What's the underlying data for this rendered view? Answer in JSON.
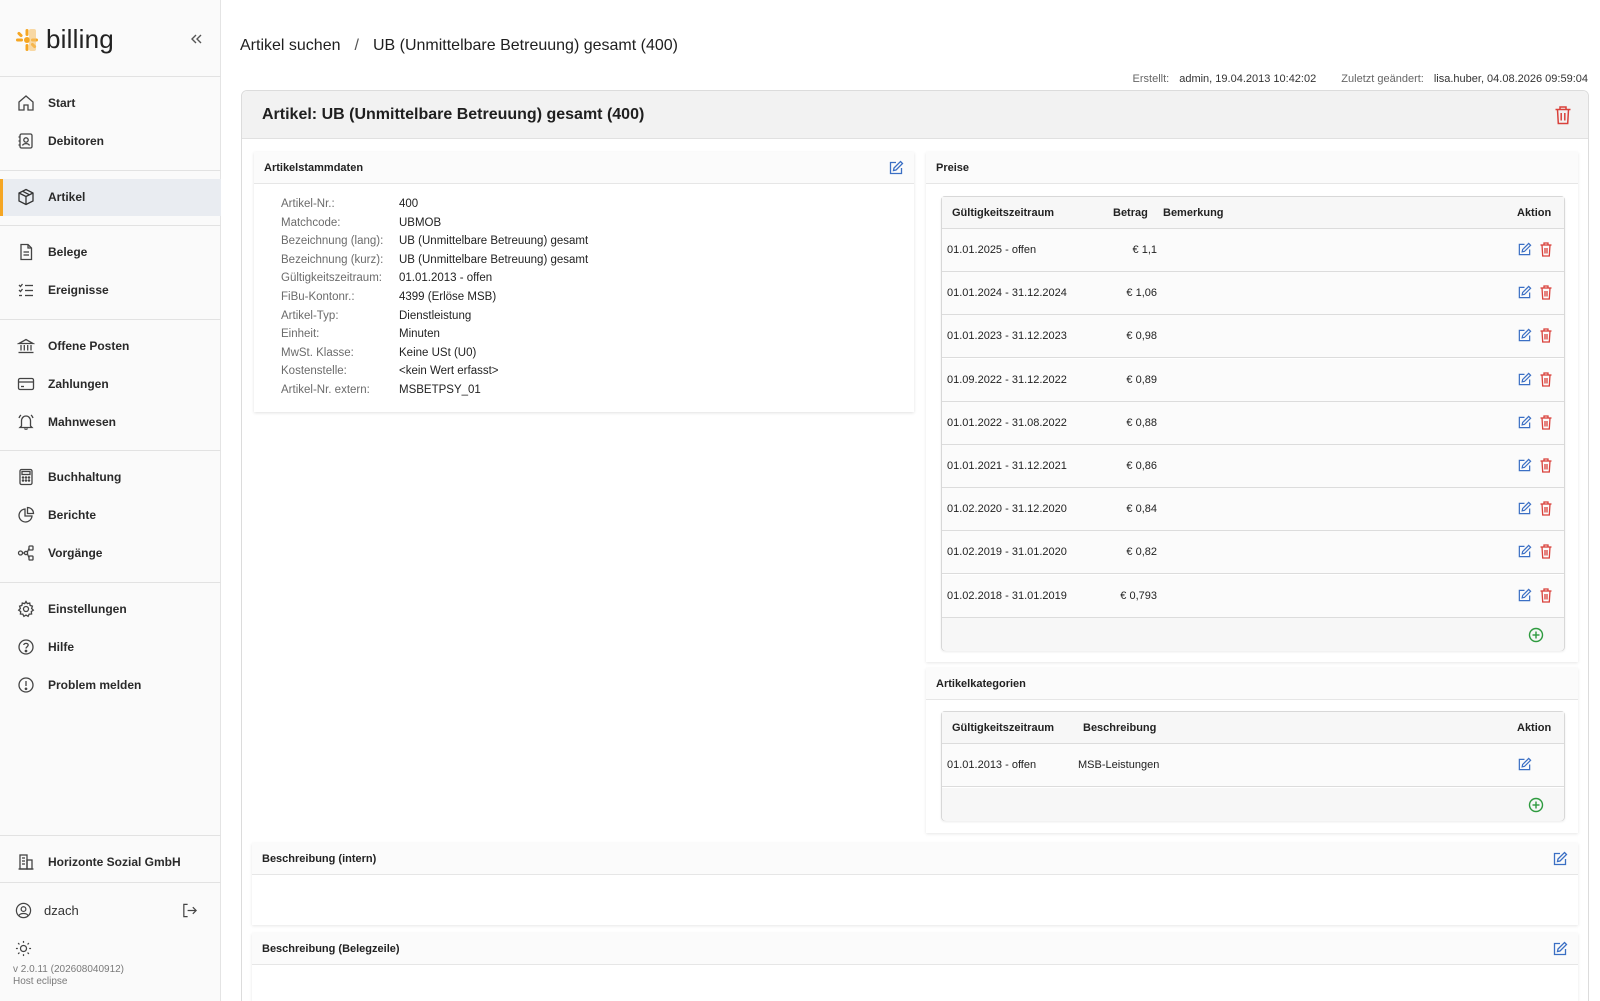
{
  "app": {
    "name": "billing"
  },
  "sidebar": {
    "items": [
      {
        "label": "Start",
        "icon": "home-icon"
      },
      {
        "label": "Debitoren",
        "icon": "contacts-icon"
      },
      {
        "label": "Artikel",
        "icon": "package-icon",
        "active": true
      },
      {
        "label": "Belege",
        "icon": "document-icon"
      },
      {
        "label": "Ereignisse",
        "icon": "checklist-icon"
      },
      {
        "label": "Offene Posten",
        "icon": "bank-icon"
      },
      {
        "label": "Zahlungen",
        "icon": "credit-card-icon"
      },
      {
        "label": "Mahnwesen",
        "icon": "bell-icon"
      },
      {
        "label": "Buchhaltung",
        "icon": "calculator-icon"
      },
      {
        "label": "Berichte",
        "icon": "pie-chart-icon"
      },
      {
        "label": "Vorgänge",
        "icon": "workflow-icon"
      },
      {
        "label": "Einstellungen",
        "icon": "gear-icon"
      },
      {
        "label": "Hilfe",
        "icon": "help-icon"
      },
      {
        "label": "Problem melden",
        "icon": "alert-icon"
      }
    ],
    "org": {
      "label": "Horizonte Sozial GmbH",
      "icon": "building-icon"
    },
    "user": {
      "name": "dzach"
    },
    "version": {
      "line1": "v 2.0.11 (202608040912)",
      "line2": "Host eclipse"
    }
  },
  "breadcrumb": {
    "parent": "Artikel suchen",
    "separator": "/",
    "current": "UB (Unmittelbare Betreuung) gesamt (400)"
  },
  "meta": {
    "created_label": "Erstellt:",
    "created_value": "admin, 19.04.2013 10:42:02",
    "changed_label": "Zuletzt geändert:",
    "changed_value": "lisa.huber, 04.08.2026 09:59:04"
  },
  "article": {
    "title": "Artikel: UB (Unmittelbare Betreuung) gesamt (400)",
    "stammdaten": {
      "title": "Artikelstammdaten",
      "fields": [
        {
          "k": "Artikel-Nr.:",
          "v": "400"
        },
        {
          "k": "Matchcode:",
          "v": "UBMOB"
        },
        {
          "k": "Bezeichnung (lang):",
          "v": "UB (Unmittelbare Betreuung) gesamt"
        },
        {
          "k": "Bezeichnung (kurz):",
          "v": "UB (Unmittelbare Betreuung) gesamt"
        },
        {
          "k": "Gültigkeitszeitraum:",
          "v": "01.01.2013 - offen"
        },
        {
          "k": "FiBu-Kontonr.:",
          "v": "4399 (Erlöse MSB)"
        },
        {
          "k": "Artikel-Typ:",
          "v": "Dienstleistung"
        },
        {
          "k": "Einheit:",
          "v": "Minuten"
        },
        {
          "k": "MwSt. Klasse:",
          "v": "Keine USt (U0)"
        },
        {
          "k": "Kostenstelle:",
          "v": "<kein Wert erfasst>"
        },
        {
          "k": "Artikel-Nr. extern:",
          "v": "MSBETPSY_01"
        }
      ]
    },
    "preise": {
      "title": "Preise",
      "columns": {
        "period": "Gültigkeitszeitraum",
        "amount": "Betrag",
        "note": "Bemerkung",
        "action": "Aktion"
      },
      "rows": [
        {
          "period": "01.01.2025 - offen",
          "amount": "€ 1,1",
          "note": ""
        },
        {
          "period": "01.01.2024 - 31.12.2024",
          "amount": "€ 1,06",
          "note": ""
        },
        {
          "period": "01.01.2023 - 31.12.2023",
          "amount": "€ 0,98",
          "note": ""
        },
        {
          "period": "01.09.2022 - 31.12.2022",
          "amount": "€ 0,89",
          "note": ""
        },
        {
          "period": "01.01.2022 - 31.08.2022",
          "amount": "€ 0,88",
          "note": ""
        },
        {
          "period": "01.01.2021 - 31.12.2021",
          "amount": "€ 0,86",
          "note": ""
        },
        {
          "period": "01.02.2020 - 31.12.2020",
          "amount": "€ 0,84",
          "note": ""
        },
        {
          "period": "01.02.2019 - 31.01.2020",
          "amount": "€ 0,82",
          "note": ""
        },
        {
          "period": "01.02.2018 - 31.01.2019",
          "amount": "€ 0,793",
          "note": ""
        }
      ]
    },
    "kategorien": {
      "title": "Artikelkategorien",
      "columns": {
        "period": "Gültigkeitszeitraum",
        "desc": "Beschreibung",
        "action": "Aktion"
      },
      "rows": [
        {
          "period": "01.01.2013 - offen",
          "desc": "MSB-Leistungen"
        }
      ]
    },
    "beschreibung_intern": {
      "title": "Beschreibung (intern)",
      "text": ""
    },
    "beschreibung_beleg": {
      "title": "Beschreibung (Belegzeile)",
      "text": ""
    }
  },
  "colors": {
    "accent": "#f5a623",
    "edit": "#3b6fc4",
    "delete": "#d9413b",
    "add": "#2e9b3f"
  }
}
